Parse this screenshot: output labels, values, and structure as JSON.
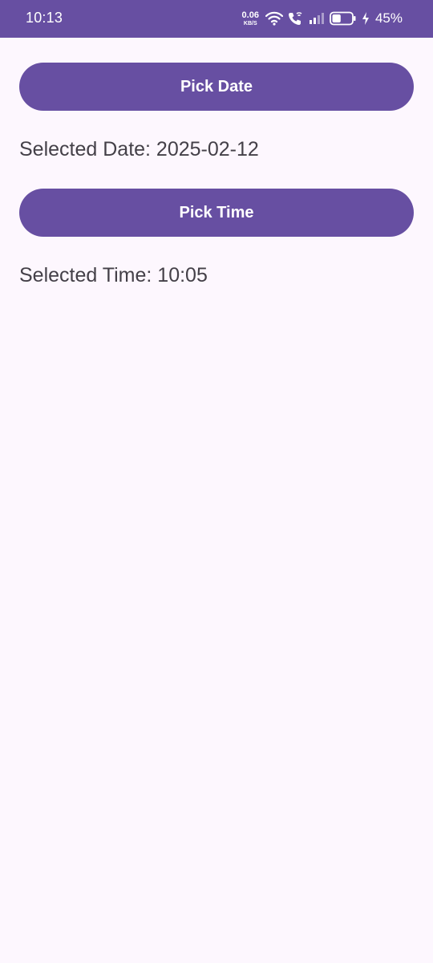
{
  "status_bar": {
    "time": "10:13",
    "net_speed_value": "0.06",
    "net_speed_unit": "KB/S",
    "battery_percent": "45%",
    "icons": [
      "wifi-icon",
      "wifi-calling-icon",
      "signal-icon",
      "battery-icon",
      "charging-icon"
    ],
    "battery_level": 0.45
  },
  "date_section": {
    "button_label": "Pick Date",
    "result_text": "Selected Date: 2025-02-12"
  },
  "time_section": {
    "button_label": "Pick Time",
    "result_text": "Selected Time: 10:05"
  },
  "colors": {
    "primary": "#674fa2",
    "background": "#fdf7fe",
    "text": "#444048"
  }
}
